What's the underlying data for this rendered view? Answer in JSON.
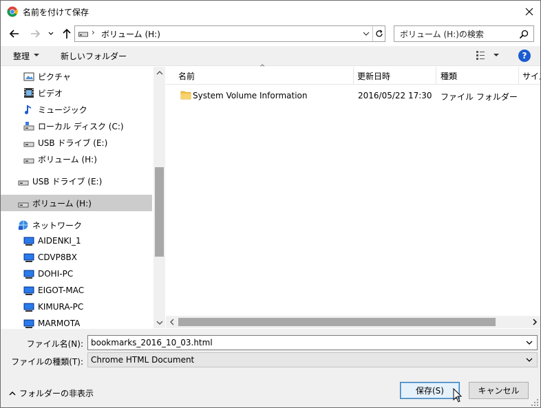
{
  "window": {
    "title": "名前を付けて保存",
    "close_label": "✕"
  },
  "nav": {
    "address_separator": "›",
    "address": "ボリューム (H:)",
    "search_placeholder": "ボリューム (H:)の検索"
  },
  "toolbar": {
    "organize": "整理",
    "new_folder": "新しいフォルダー",
    "help": "?"
  },
  "sidebar": {
    "items": [
      {
        "label": "ピクチャ",
        "icon": "pictures-icon"
      },
      {
        "label": "ビデオ",
        "icon": "videos-icon"
      },
      {
        "label": "ミュージック",
        "icon": "music-icon"
      },
      {
        "label": "ローカル ディスク (C:)",
        "icon": "local-disk-icon"
      },
      {
        "label": "USB ドライブ (E:)",
        "icon": "usb-drive-icon"
      },
      {
        "label": "ボリューム (H:)",
        "icon": "drive-icon"
      },
      {
        "label": "USB ドライブ (E:)",
        "icon": "usb-drive-icon"
      },
      {
        "label": "ボリューム (H:)",
        "icon": "drive-icon"
      },
      {
        "label": "ネットワーク",
        "icon": "network-icon"
      },
      {
        "label": "AIDENKI_1",
        "icon": "computer-icon"
      },
      {
        "label": "CDVP8BX",
        "icon": "computer-icon"
      },
      {
        "label": "DOHI-PC",
        "icon": "computer-icon"
      },
      {
        "label": "EIGOT-MAC",
        "icon": "computer-icon"
      },
      {
        "label": "KIMURA-PC",
        "icon": "computer-icon"
      },
      {
        "label": "MARMOTA",
        "icon": "computer-icon"
      }
    ],
    "selected_index": 7
  },
  "list": {
    "columns": [
      "名前",
      "更新日時",
      "種類",
      "サイズ"
    ],
    "rows": [
      {
        "name": "System Volume Information",
        "modified": "2016/05/22 17:30",
        "type": "ファイル フォルダー"
      }
    ]
  },
  "form": {
    "filename_label": "ファイル名(N):",
    "filename_value": "bookmarks_2016_10_03.html",
    "filetype_label": "ファイルの種類(T):",
    "filetype_value": "Chrome HTML Document",
    "hide_folders": "フォルダーの非表示",
    "save": "保存(S)",
    "cancel": "キャンセル"
  },
  "colors": {
    "accent": "#1c5bd0",
    "selection": "#cccccc",
    "panel": "#f0f0f0",
    "folder": "#f5c242"
  }
}
